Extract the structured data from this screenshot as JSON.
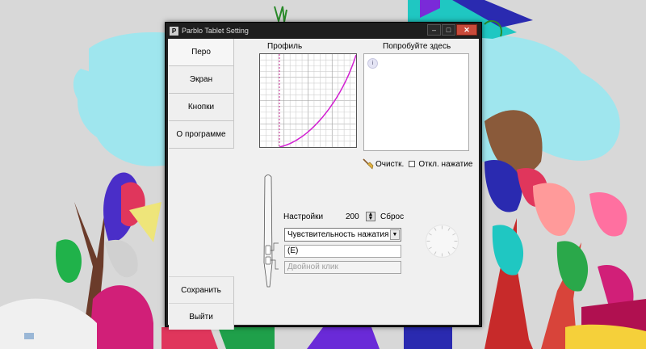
{
  "window": {
    "title": "Parblo Tablet Setting",
    "app_icon_glyph": "P",
    "minimize_glyph": "–",
    "maximize_glyph": "□",
    "close_glyph": "✕"
  },
  "nav": {
    "items": [
      {
        "label": "Перо"
      },
      {
        "label": "Экран"
      },
      {
        "label": "Кнопки"
      },
      {
        "label": "О программе"
      }
    ],
    "active_index": 0
  },
  "actions": {
    "save_label": "Сохранить",
    "exit_label": "Выйти"
  },
  "profile": {
    "title": "Профиль",
    "curve_color": "#d21fd2",
    "marker_color": "#c0208c"
  },
  "try_area": {
    "title": "Попробуйте здесь",
    "cursor_glyph": "i"
  },
  "clear": {
    "label": "Очистк.",
    "disable_pressure_label": "Откл. нажатие",
    "disable_pressure_checked": false
  },
  "settings": {
    "label": "Настройки",
    "value": "200",
    "reset_label": "Сброс",
    "mode_selected": "Чувствительность нажатия",
    "dropdown_glyph": "▼",
    "button1_value": "(E)",
    "button2_placeholder": "Двойной клик"
  }
}
